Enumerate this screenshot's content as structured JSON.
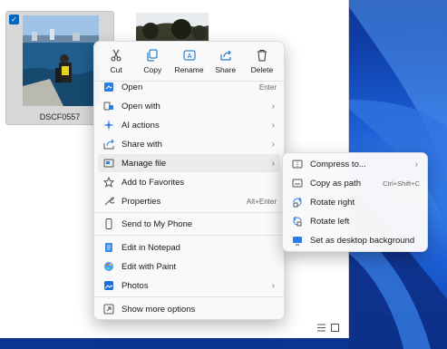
{
  "thumbnails": [
    {
      "caption": "DSCF0557",
      "selected": true
    },
    {
      "caption": "",
      "selected": false
    }
  ],
  "quick_actions": [
    {
      "label": "Cut",
      "icon": "scissors-icon"
    },
    {
      "label": "Copy",
      "icon": "copy-icon"
    },
    {
      "label": "Rename",
      "icon": "rename-icon"
    },
    {
      "label": "Share",
      "icon": "share-icon"
    },
    {
      "label": "Delete",
      "icon": "trash-icon"
    }
  ],
  "menu_items": [
    {
      "label": "Open",
      "shortcut": "Enter",
      "icon": "open-icon",
      "submenu": false
    },
    {
      "label": "Open with",
      "shortcut": "",
      "icon": "open-with-icon",
      "submenu": true
    },
    {
      "label": "AI actions",
      "shortcut": "",
      "icon": "sparkle-icon",
      "submenu": true
    },
    {
      "label": "Share with",
      "shortcut": "",
      "icon": "share-with-icon",
      "submenu": true
    },
    {
      "label": "Manage file",
      "shortcut": "",
      "icon": "manage-file-icon",
      "submenu": true
    },
    {
      "label": "Add to Favorites",
      "shortcut": "",
      "icon": "star-icon",
      "submenu": false
    },
    {
      "label": "Properties",
      "shortcut": "Alt+Enter",
      "icon": "wrench-icon",
      "submenu": false
    },
    {
      "label": "Send to My Phone",
      "shortcut": "",
      "icon": "phone-icon",
      "submenu": false
    },
    {
      "label": "Edit in Notepad",
      "shortcut": "",
      "icon": "notepad-icon",
      "submenu": false
    },
    {
      "label": "Edit with Paint",
      "shortcut": "",
      "icon": "paint-icon",
      "submenu": false
    },
    {
      "label": "Photos",
      "shortcut": "",
      "icon": "photos-icon",
      "submenu": true
    },
    {
      "label": "Show more options",
      "shortcut": "",
      "icon": "more-options-icon",
      "submenu": false
    }
  ],
  "submenu_items": [
    {
      "label": "Compress to...",
      "shortcut": "",
      "icon": "compress-icon",
      "submenu": true
    },
    {
      "label": "Copy as path",
      "shortcut": "Ctrl+Shift+C",
      "icon": "copy-path-icon",
      "submenu": false
    },
    {
      "label": "Rotate right",
      "shortcut": "",
      "icon": "rotate-right-icon",
      "submenu": false
    },
    {
      "label": "Rotate left",
      "shortcut": "",
      "icon": "rotate-left-icon",
      "submenu": false
    },
    {
      "label": "Set as desktop background",
      "shortcut": "",
      "icon": "desktop-bg-icon",
      "submenu": false
    }
  ],
  "colors": {
    "accent": "#0067c0",
    "menu_bg": "#f9f9f9",
    "hover": "#ebebeb",
    "wallpaper": "#1d5fd6"
  }
}
